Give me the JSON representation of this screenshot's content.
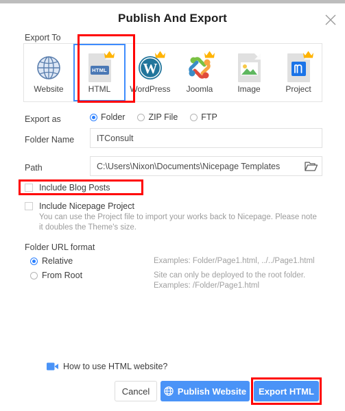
{
  "dialog": {
    "title": "Publish And Export",
    "close_icon": "close-icon"
  },
  "export_to": {
    "label": "Export To",
    "selected": "HTML",
    "targets": [
      {
        "label": "Website",
        "icon": "globe-icon",
        "premium": false,
        "selected": false
      },
      {
        "label": "HTML",
        "icon": "html-file-icon",
        "premium": true,
        "selected": true,
        "tag": "HTML"
      },
      {
        "label": "WordPress",
        "icon": "wordpress-icon",
        "premium": true,
        "selected": false
      },
      {
        "label": "Joomla",
        "icon": "joomla-icon",
        "premium": true,
        "selected": false
      },
      {
        "label": "Image",
        "icon": "image-file-icon",
        "premium": false,
        "selected": false
      },
      {
        "label": "Project",
        "icon": "project-file-icon",
        "premium": true,
        "selected": false
      }
    ]
  },
  "export_as": {
    "label": "Export as",
    "selected": "Folder",
    "options": [
      {
        "label": "Folder",
        "checked": true
      },
      {
        "label": "ZIP File",
        "checked": false
      },
      {
        "label": "FTP",
        "checked": false
      }
    ]
  },
  "folder_name": {
    "label": "Folder Name",
    "value": "ITConsult",
    "placeholder": "Folder Name"
  },
  "path": {
    "label": "Path",
    "value": "C:\\Users\\Nixon\\Documents\\Nicepage Templates",
    "placeholder": "Path",
    "browse_icon": "folder-open-icon"
  },
  "checkboxes": {
    "include_blog": {
      "label": "Include Blog Posts",
      "checked": false
    },
    "include_project": {
      "label": "Include Nicepage Project",
      "checked": false,
      "help": "You can use the Project file to import your works back to Nicepage. Please note it doubles the Theme's size."
    }
  },
  "url_format": {
    "label": "Folder URL format",
    "selected": "Relative",
    "options": [
      {
        "label": "Relative",
        "checked": true,
        "example": "Examples: Folder/Page1.html, ../../Page1.html"
      },
      {
        "label": "From Root",
        "checked": false,
        "example": "Site can only be deployed to the root folder.\nExamples: /Folder/Page1.html"
      }
    ]
  },
  "footer": {
    "howto_label": "How to use HTML website?",
    "howto_icon": "video-camera-icon",
    "cancel_label": "Cancel",
    "publish_label": "Publish Website",
    "publish_icon": "globe-icon",
    "export_label": "Export HTML"
  },
  "colors": {
    "accent": "#4a93f7",
    "radio_accent": "#2a7fff",
    "selection_border": "#3d8bfd",
    "annotation_red": "#ff0000",
    "crown_gold": "#ffb300",
    "muted_text": "#9b9b9b"
  }
}
